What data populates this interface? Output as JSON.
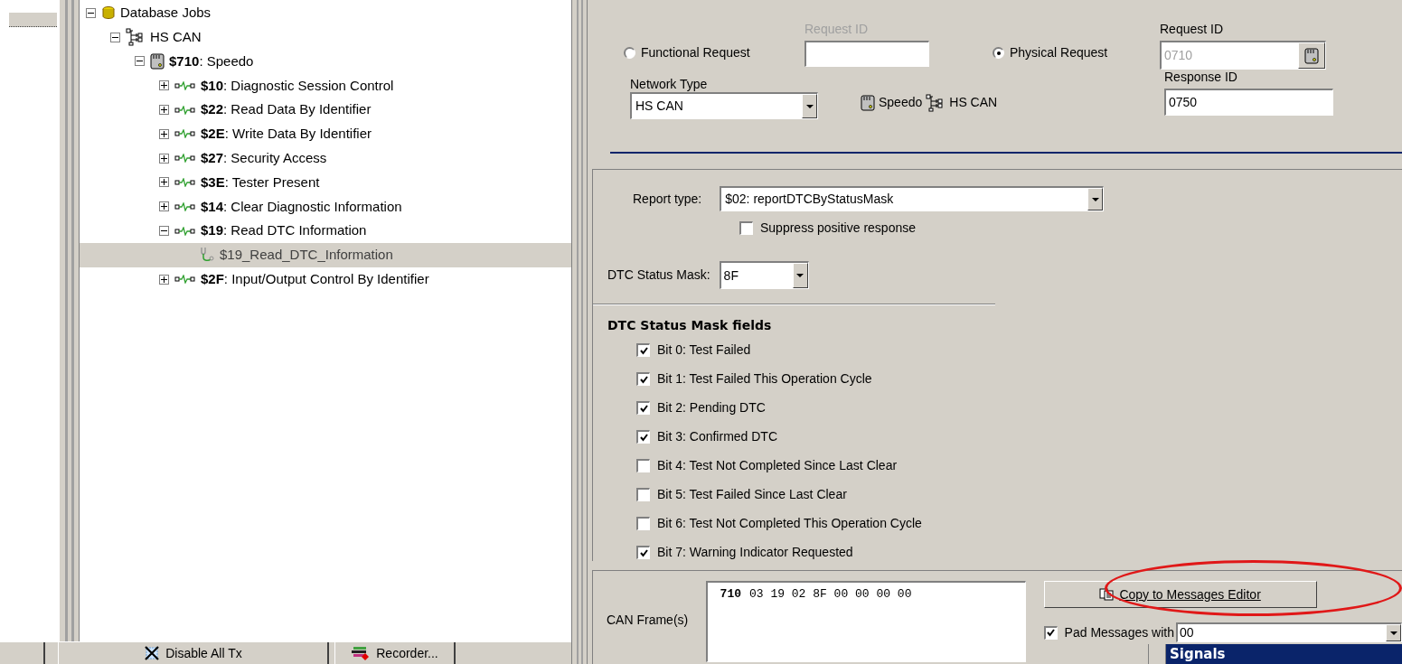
{
  "tree": [
    {
      "kind": "database",
      "label": "Database Jobs",
      "expanded": true,
      "selected": false,
      "children": [
        {
          "kind": "network",
          "label": "HS CAN",
          "expanded": true,
          "selected": false,
          "children": [
            {
              "kind": "ecu",
              "label": "**$710**: Speedo",
              "expanded": true,
              "selected": false,
              "children": [
                {
                  "kind": "service",
                  "label": "**$10**: Diagnostic Session Control",
                  "expanded": false,
                  "selected": false
                },
                {
                  "kind": "service",
                  "label": "**$22**: Read Data By Identifier",
                  "expanded": false,
                  "selected": false
                },
                {
                  "kind": "service",
                  "label": "**$2E**: Write Data By Identifier",
                  "expanded": false,
                  "selected": false
                },
                {
                  "kind": "service",
                  "label": "**$27**: Security Access",
                  "expanded": false,
                  "selected": false
                },
                {
                  "kind": "service",
                  "label": "**$3E**: Tester Present",
                  "expanded": false,
                  "selected": false
                },
                {
                  "kind": "service",
                  "label": "**$14**: Clear Diagnostic Information",
                  "expanded": false,
                  "selected": false
                },
                {
                  "kind": "service",
                  "label": "**$19**: Read DTC Information",
                  "expanded": true,
                  "selected": false,
                  "children": [
                    {
                      "kind": "job",
                      "label": "$19_Read_DTC_Information",
                      "selected": true
                    }
                  ]
                },
                {
                  "kind": "service",
                  "label": "**$2F**: Input/Output Control By Identifier",
                  "expanded": false,
                  "selected": false
                }
              ]
            }
          ]
        }
      ]
    }
  ],
  "request": {
    "functional": {
      "label": "Functional Request",
      "selected": false
    },
    "functional_id": {
      "label": "Request ID",
      "disabled": true
    },
    "physical": {
      "label": "Physical Request",
      "selected": true
    },
    "physical_id": {
      "label": "Request ID",
      "value": "0710",
      "disabled": false,
      "readonly": true
    }
  },
  "network_type": {
    "label": "Network Type",
    "value": "HS CAN"
  },
  "target": {
    "ecu": "Speedo",
    "network": "HS CAN"
  },
  "response_id": {
    "label": "Response ID",
    "value": "0750"
  },
  "report": {
    "label": "Report type:",
    "value": "$02: reportDTCByStatusMask"
  },
  "suppress": {
    "label": "Suppress positive response",
    "checked": false
  },
  "status_mask": {
    "label": "DTC Status Mask:",
    "value": "8F"
  },
  "mask_fields": {
    "title": "DTC Status Mask fields",
    "bits": [
      {
        "label": "Bit 0: Test Failed",
        "checked": true
      },
      {
        "label": "Bit 1: Test Failed This Operation Cycle",
        "checked": true
      },
      {
        "label": "Bit 2: Pending DTC",
        "checked": true
      },
      {
        "label": "Bit 3: Confirmed DTC",
        "checked": true
      },
      {
        "label": "Bit 4: Test Not Completed Since Last Clear",
        "checked": false
      },
      {
        "label": "Bit 5: Test Failed Since Last Clear",
        "checked": false
      },
      {
        "label": "Bit 6: Test Not Completed This Operation Cycle",
        "checked": false
      },
      {
        "label": "Bit 7: Warning Indicator Requested",
        "checked": true
      }
    ]
  },
  "can_frame": {
    "label": "CAN Frame(s)",
    "frames": [
      {
        "id": "710",
        "bytes": "03 19 02 8F 00 00 00 00"
      }
    ]
  },
  "copy_button": {
    "label": "Copy to Messages Editor",
    "highlighted": true
  },
  "pad": {
    "label": "Pad Messages with",
    "checked": true,
    "value": "00"
  },
  "signals_panel": {
    "title": "Signals"
  },
  "toolbar": [
    {
      "kind": "disable_tx",
      "label": "Disable All Tx"
    },
    {
      "kind": "recorder",
      "label": "Recorder..."
    }
  ]
}
